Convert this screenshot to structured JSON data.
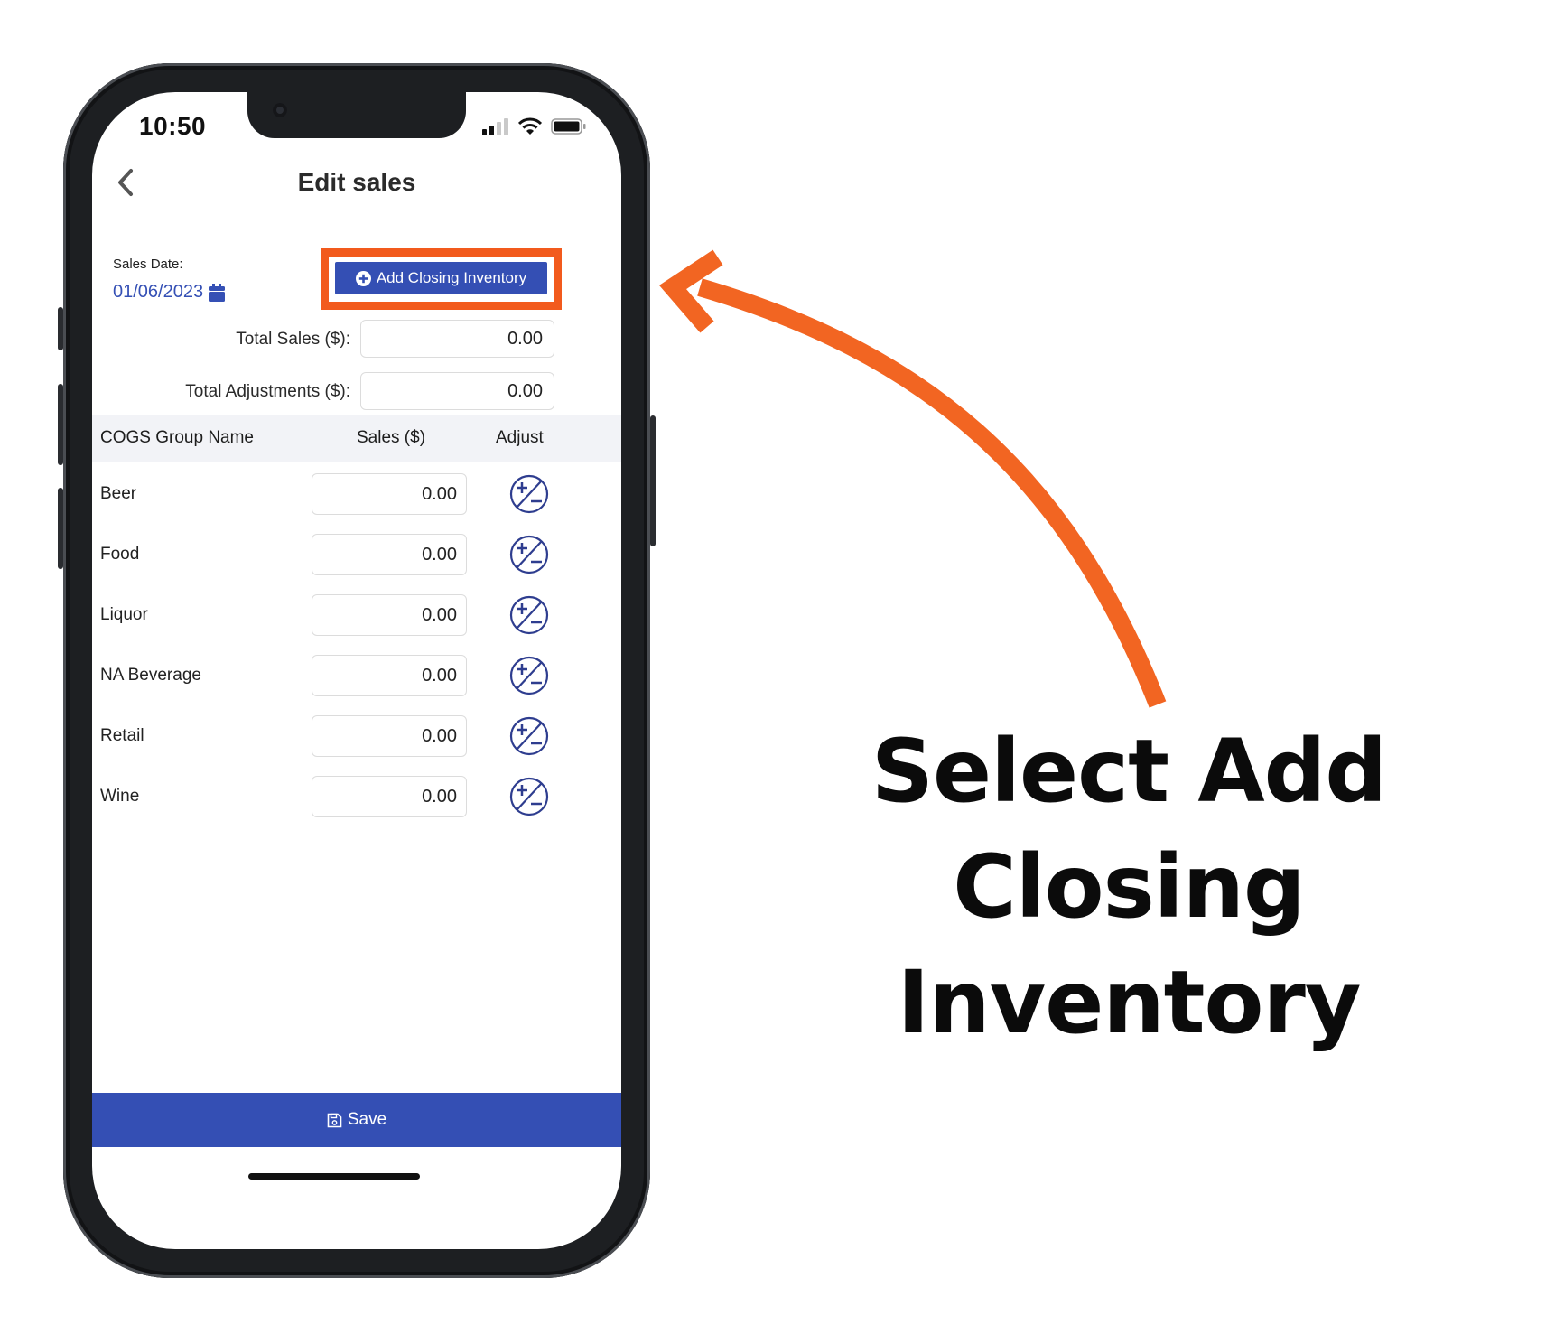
{
  "status_bar": {
    "time": "10:50"
  },
  "header": {
    "title": "Edit sales"
  },
  "sales_date": {
    "label": "Sales Date:",
    "value": "01/06/2023"
  },
  "add_closing_inventory": {
    "label": "Add Closing Inventory"
  },
  "totals": {
    "total_sales_label": "Total Sales ($):",
    "total_sales_value": "0.00",
    "total_adjustments_label": "Total Adjustments ($):",
    "total_adjustments_value": "0.00"
  },
  "table": {
    "headers": [
      "COGS Group Name",
      "Sales ($)",
      "Adjust"
    ],
    "rows": [
      {
        "name": "Beer",
        "sales": "0.00"
      },
      {
        "name": "Food",
        "sales": "0.00"
      },
      {
        "name": "Liquor",
        "sales": "0.00"
      },
      {
        "name": "NA Beverage",
        "sales": "0.00"
      },
      {
        "name": "Retail",
        "sales": "0.00"
      },
      {
        "name": "Wine",
        "sales": "0.00"
      }
    ]
  },
  "save": {
    "label": "Save"
  },
  "annotation": {
    "line1": "Select Add Closing",
    "line2": "Inventory"
  },
  "colors": {
    "primary": "#344fb4",
    "highlight": "#f25a1d",
    "arrow": "#f26522"
  },
  "icons": [
    "chevron-left-icon",
    "calendar-icon",
    "plus-circle-icon",
    "plus-minus-icon",
    "save-icon",
    "signal-icon",
    "wifi-icon",
    "battery-icon"
  ]
}
